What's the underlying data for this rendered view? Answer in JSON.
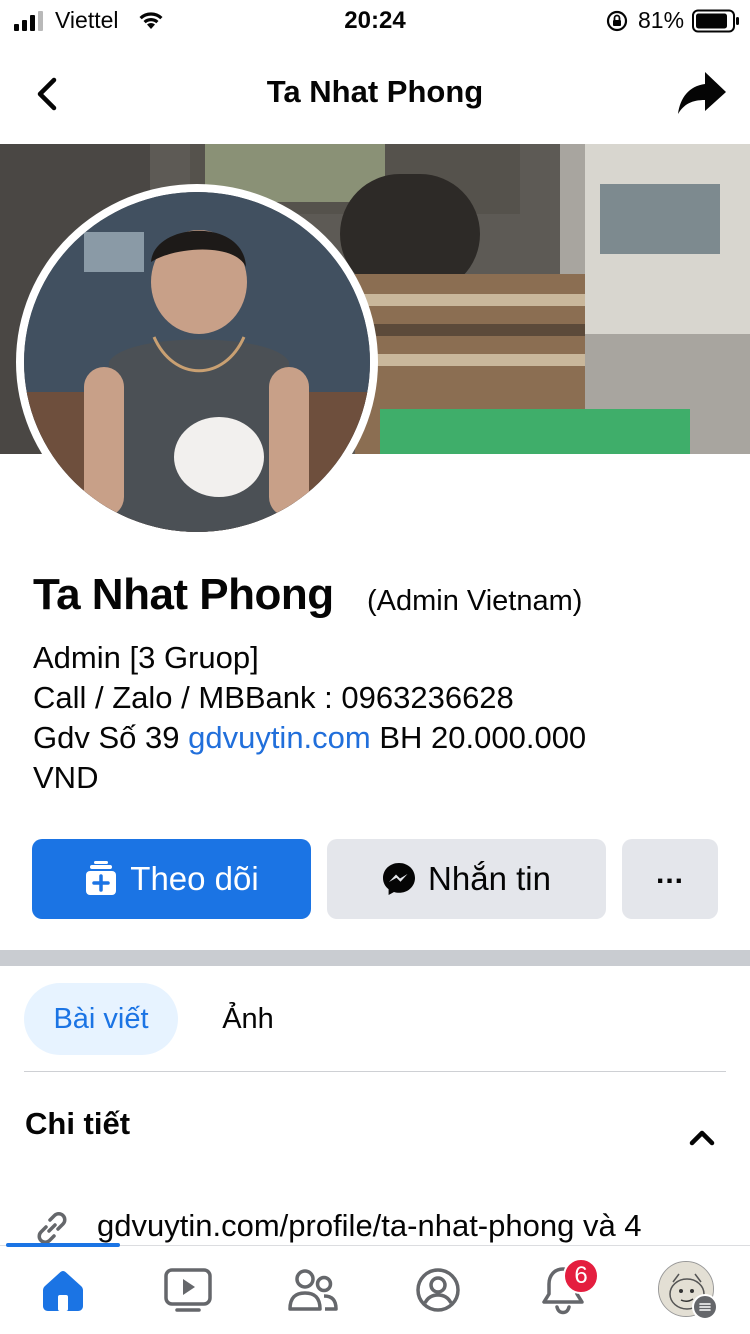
{
  "status_bar": {
    "carrier": "Viettel",
    "time": "20:24",
    "battery": "81%"
  },
  "header": {
    "title": "Ta Nhat Phong"
  },
  "profile": {
    "name": "Ta Nhat Phong",
    "suffix": "(Admin Vietnam)",
    "bio_line1": "Admin [3 Gruop]",
    "bio_line2": "Call / Zalo / MBBank : 0963236628",
    "bio_line3_prefix": "Gdv Số 39 ",
    "bio_line3_link": "gdvuytin.com",
    "bio_line3_suffix": " BH 20.000.000",
    "bio_line4": "VND"
  },
  "actions": {
    "follow_label": "Theo dõi",
    "message_label": "Nhắn tin",
    "more_label": "..."
  },
  "tabs": {
    "posts": "Bài viết",
    "photos": "Ảnh"
  },
  "details": {
    "title": "Chi tiết",
    "link_text": "gdvuytin.com/profile/ta-nhat-phong và 4"
  },
  "bottom_nav": {
    "notifications_count": "6"
  },
  "colors": {
    "accent": "#1b74e4",
    "link": "#216fdb",
    "button_gray": "#e4e6eb",
    "badge": "#e41e3f"
  }
}
